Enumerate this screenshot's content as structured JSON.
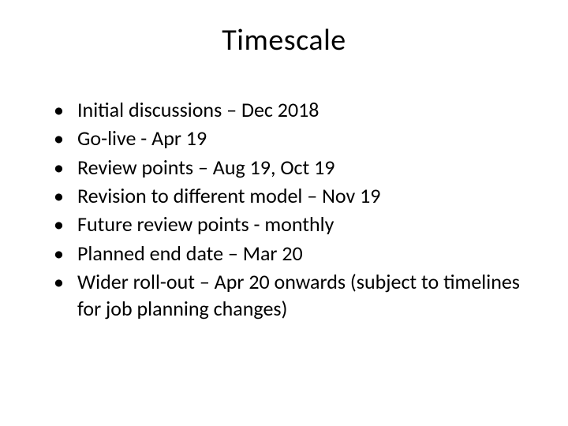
{
  "slide": {
    "title": "Timescale",
    "bullets": [
      "Initial discussions – Dec 2018",
      "Go-live - Apr 19",
      "Review points – Aug 19, Oct 19",
      "Revision to different model – Nov 19",
      "Future review points - monthly",
      "Planned end date – Mar 20",
      "Wider roll-out – Apr 20 onwards (subject to timelines for job planning changes)"
    ]
  }
}
